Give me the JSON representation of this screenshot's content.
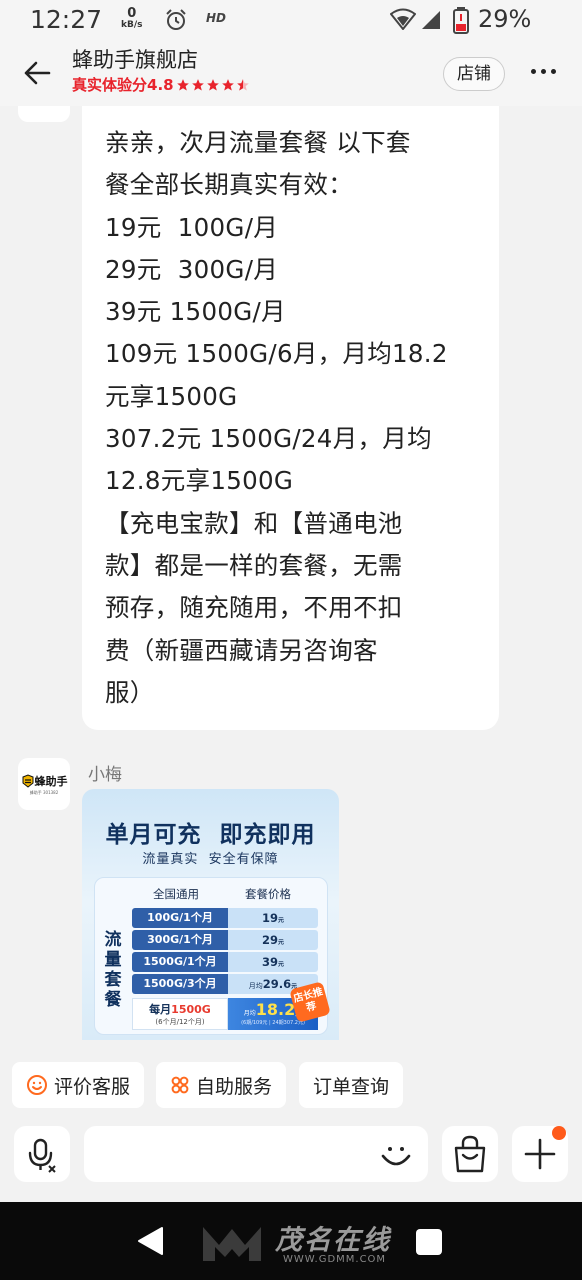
{
  "status_bar": {
    "time": "12:27",
    "speed_value": "0",
    "speed_unit": "kB/s",
    "hd_label": "HD",
    "battery": "29%"
  },
  "header": {
    "store_name": "蜂助手旗舰店",
    "rating_label": "真实体验分4.8",
    "stars": 4.5,
    "store_button": "店铺"
  },
  "message": {
    "text": "亲亲，次月流量套餐 以下套\n餐全部长期真实有效：\n19元  100G/月\n29元  300G/月\n39元 1500G/月\n109元 1500G/6月，月均18.2\n元享1500G\n307.2元 1500G/24月，月均\n12.8元享1500G\n【充电宝款】和【普通电池\n款】都是一样的套餐，无需\n预存，随充随用，不用不扣\n费（新疆西藏请另咨询客\n服）"
  },
  "sender": {
    "name": "小梅",
    "avatar_logo": "蜂助手",
    "avatar_sub": "蜂助手 301382"
  },
  "promo_card": {
    "title": "单月可充  即充即用",
    "subtitle": "流量真实  安全有保障",
    "side_label": "流量套餐",
    "col_plan": "全国通用",
    "col_price": "套餐价格",
    "rows": [
      {
        "plan": "100G/1个月",
        "price": "19",
        "unit": "元"
      },
      {
        "plan": "300G/1个月",
        "price": "29",
        "unit": "元"
      },
      {
        "plan": "1500G/1个月",
        "price": "39",
        "unit": "元"
      },
      {
        "plan": "1500G/3个月",
        "price": "29.6",
        "unit": "元",
        "prefix": "月均"
      }
    ],
    "last_plan_line1_a": "每月",
    "last_plan_line1_b": "1500G",
    "last_plan_line2": "(6个月/12个月)",
    "last_price_prefix": "月均",
    "last_price": "18.2",
    "last_price_unit": "元",
    "last_price_note": "(6期/109元 | 24期307.2元)",
    "badge": "店长推荐"
  },
  "quick_actions": [
    {
      "label": "评价客服",
      "icon": "smile-icon"
    },
    {
      "label": "自助服务",
      "icon": "grid-flower-icon"
    },
    {
      "label": "订单查询",
      "icon": ""
    }
  ],
  "nav": {
    "watermark": "茂名在线",
    "watermark_url": "WWW.GDMM.COM"
  }
}
